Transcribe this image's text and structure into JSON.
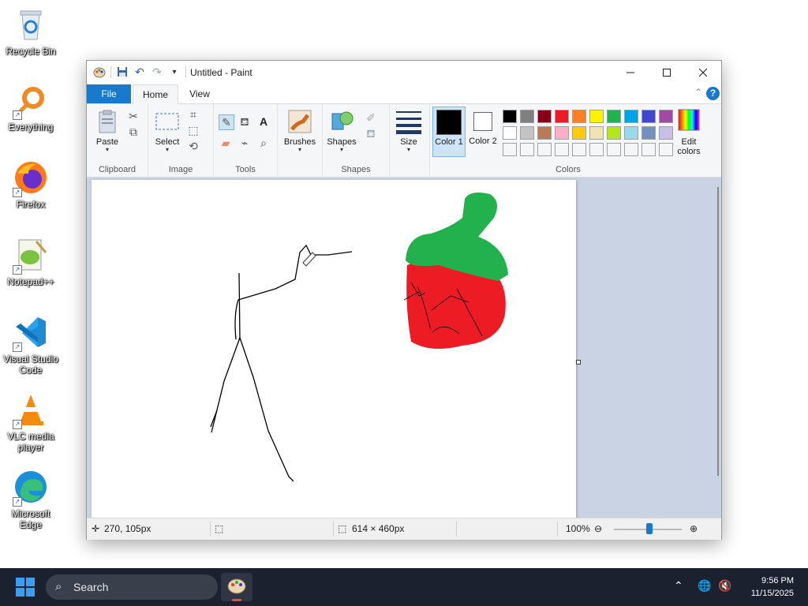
{
  "desktop": {
    "icons": [
      {
        "label": "Recycle Bin",
        "icon": "recycle-bin-icon"
      },
      {
        "label": "Everything",
        "icon": "everything-search-icon"
      },
      {
        "label": "Firefox",
        "icon": "firefox-icon"
      },
      {
        "label": "Notepad++",
        "icon": "notepad-plus-plus-icon"
      },
      {
        "label": "Visual Studio Code",
        "icon": "vscode-icon"
      },
      {
        "label": "VLC media player",
        "icon": "vlc-icon"
      },
      {
        "label": "Microsoft Edge",
        "icon": "edge-icon"
      }
    ]
  },
  "window": {
    "title": "Untitled - Paint",
    "tabs": {
      "file": "File",
      "home": "Home",
      "view": "View"
    },
    "help": "?"
  },
  "ribbon": {
    "clipboard": {
      "label": "Clipboard",
      "paste": "Paste"
    },
    "image": {
      "label": "Image",
      "select": "Select"
    },
    "tools": {
      "label": "Tools",
      "text_tool": "A"
    },
    "brushes": {
      "label": "Brushes"
    },
    "shapes": {
      "label": "Shapes",
      "button": "Shapes"
    },
    "size": {
      "label": "Size"
    },
    "colors": {
      "label": "Colors",
      "color1": "Color 1",
      "color2": "Color 2",
      "edit_colors": "Edit colors",
      "color1_value": "#000000",
      "color2_value": "#ffffff",
      "palette_row1": [
        "#000000",
        "#7f7f7f",
        "#880015",
        "#ed1c24",
        "#ff7f27",
        "#fff200",
        "#22b14c",
        "#00a2e8",
        "#3f48cc",
        "#a349a4"
      ],
      "palette_row2": [
        "#ffffff",
        "#c3c3c3",
        "#b97a57",
        "#ffaec9",
        "#ffc90e",
        "#efe4b0",
        "#b5e61d",
        "#99d9ea",
        "#7092be",
        "#c8bfe7"
      ]
    }
  },
  "statusbar": {
    "cursor_pos": "270, 105px",
    "image_size": "614 × 460px",
    "zoom": "100%",
    "zoom_level": 1.0
  },
  "taskbar": {
    "search_placeholder": "Search",
    "time": "9:56 PM",
    "date": "11/15/2025"
  }
}
